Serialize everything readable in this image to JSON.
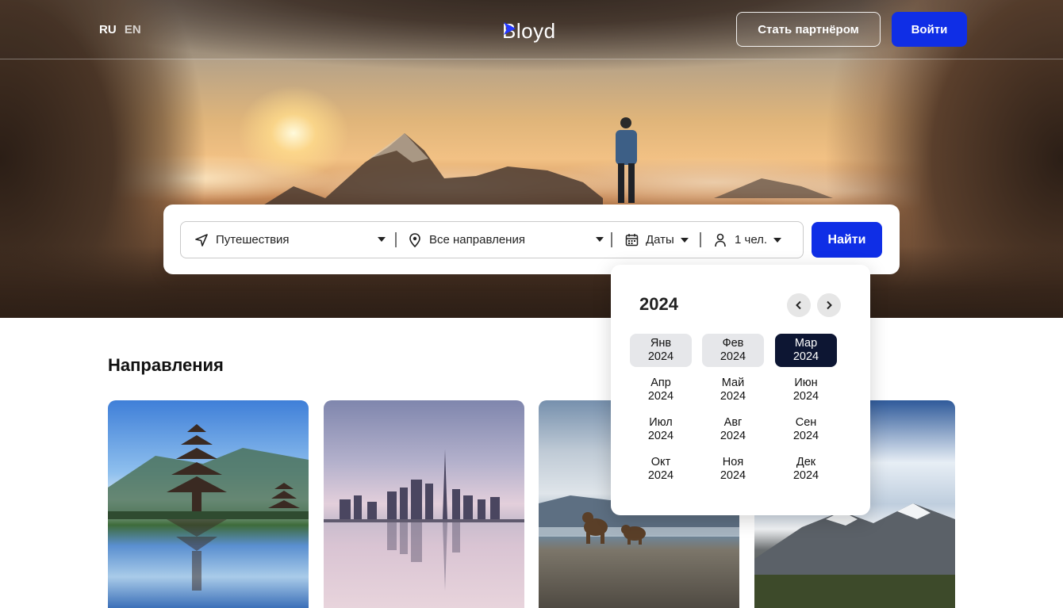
{
  "header": {
    "languages": [
      {
        "code": "RU",
        "active": true
      },
      {
        "code": "EN",
        "active": false
      }
    ],
    "logo_text": "Bloyd",
    "partner_label": "Стать партнёром",
    "login_label": "Войти"
  },
  "search": {
    "travel_type": "Путешествия",
    "destination": "Все направления",
    "dates": "Даты",
    "people": "1 чел.",
    "find_label": "Найти"
  },
  "calendar": {
    "year": "2024",
    "months": [
      {
        "name": "Янв",
        "year": "2024",
        "state": "past"
      },
      {
        "name": "Фев",
        "year": "2024",
        "state": "past"
      },
      {
        "name": "Мар",
        "year": "2024",
        "state": "selected"
      },
      {
        "name": "Апр",
        "year": "2024",
        "state": "normal"
      },
      {
        "name": "Май",
        "year": "2024",
        "state": "normal"
      },
      {
        "name": "Июн",
        "year": "2024",
        "state": "normal"
      },
      {
        "name": "Июл",
        "year": "2024",
        "state": "normal"
      },
      {
        "name": "Авг",
        "year": "2024",
        "state": "normal"
      },
      {
        "name": "Сен",
        "year": "2024",
        "state": "normal"
      },
      {
        "name": "Окт",
        "year": "2024",
        "state": "normal"
      },
      {
        "name": "Ноя",
        "year": "2024",
        "state": "normal"
      },
      {
        "name": "Дек",
        "year": "2024",
        "state": "normal"
      }
    ]
  },
  "destinations": {
    "title": "Направления",
    "cards": [
      {
        "image": "bali-temple-lake-photo"
      },
      {
        "image": "dubai-skyline-reflection-photo"
      },
      {
        "image": "kamchatka-bears-beach-photo"
      },
      {
        "image": "snowy-mountains-photo"
      }
    ]
  },
  "colors": {
    "accent": "#0f2ee6",
    "selected_month": "#0d1633",
    "past_month": "#e6e7ea"
  }
}
